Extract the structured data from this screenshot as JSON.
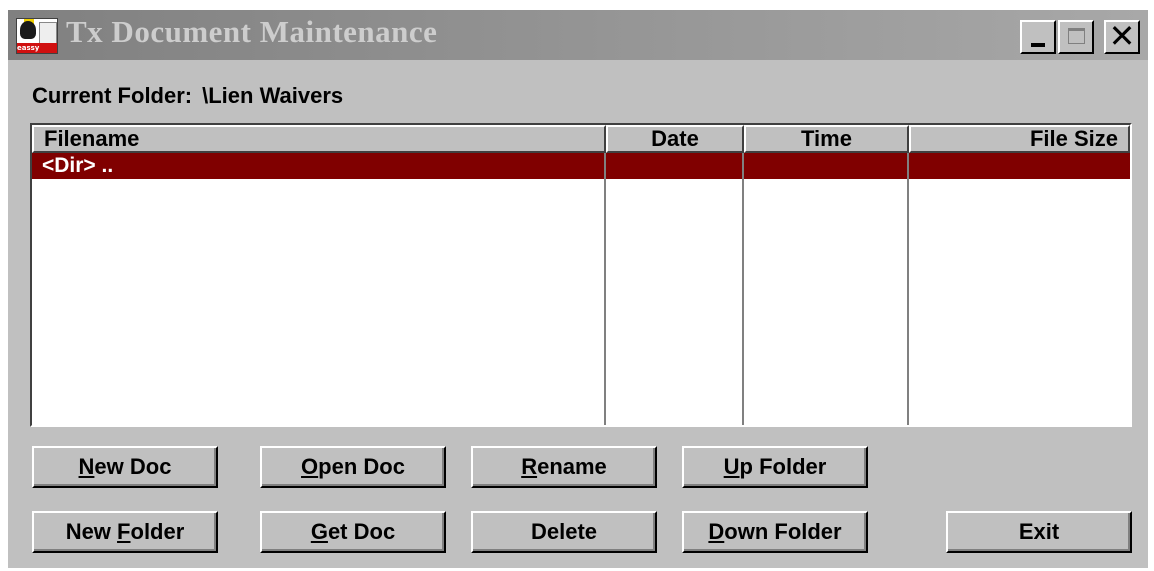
{
  "window": {
    "title": "Tx Document Maintenance",
    "icon_text": "eassy",
    "controls": {
      "minimize": "minimize-icon",
      "maximize": "maximize-icon",
      "close": "✕"
    }
  },
  "current_folder": {
    "label": "Current Folder:",
    "value": "\\Lien Waivers"
  },
  "file_list": {
    "columns": [
      "Filename",
      "Date",
      "Time",
      "File Size"
    ],
    "rows": [
      {
        "filename": "<Dir> ..",
        "date": "",
        "time": "",
        "size": ""
      }
    ],
    "selected_row_color": "#800000"
  },
  "buttons": {
    "new_doc": {
      "pre": "",
      "key": "N",
      "post": "ew Doc"
    },
    "open_doc": {
      "pre": "",
      "key": "O",
      "post": "pen Doc"
    },
    "rename": {
      "pre": "",
      "key": "R",
      "post": "ename"
    },
    "up_folder": {
      "pre": "",
      "key": "U",
      "post": "p Folder"
    },
    "new_folder": {
      "pre": "New ",
      "key": "F",
      "post": "older"
    },
    "get_doc": {
      "pre": "",
      "key": "G",
      "post": "et Doc"
    },
    "delete": {
      "pre": "Delete",
      "key": "",
      "post": ""
    },
    "down_folder": {
      "pre": "",
      "key": "D",
      "post": "own Folder"
    },
    "exit": {
      "pre": "Exit",
      "key": "",
      "post": ""
    }
  }
}
